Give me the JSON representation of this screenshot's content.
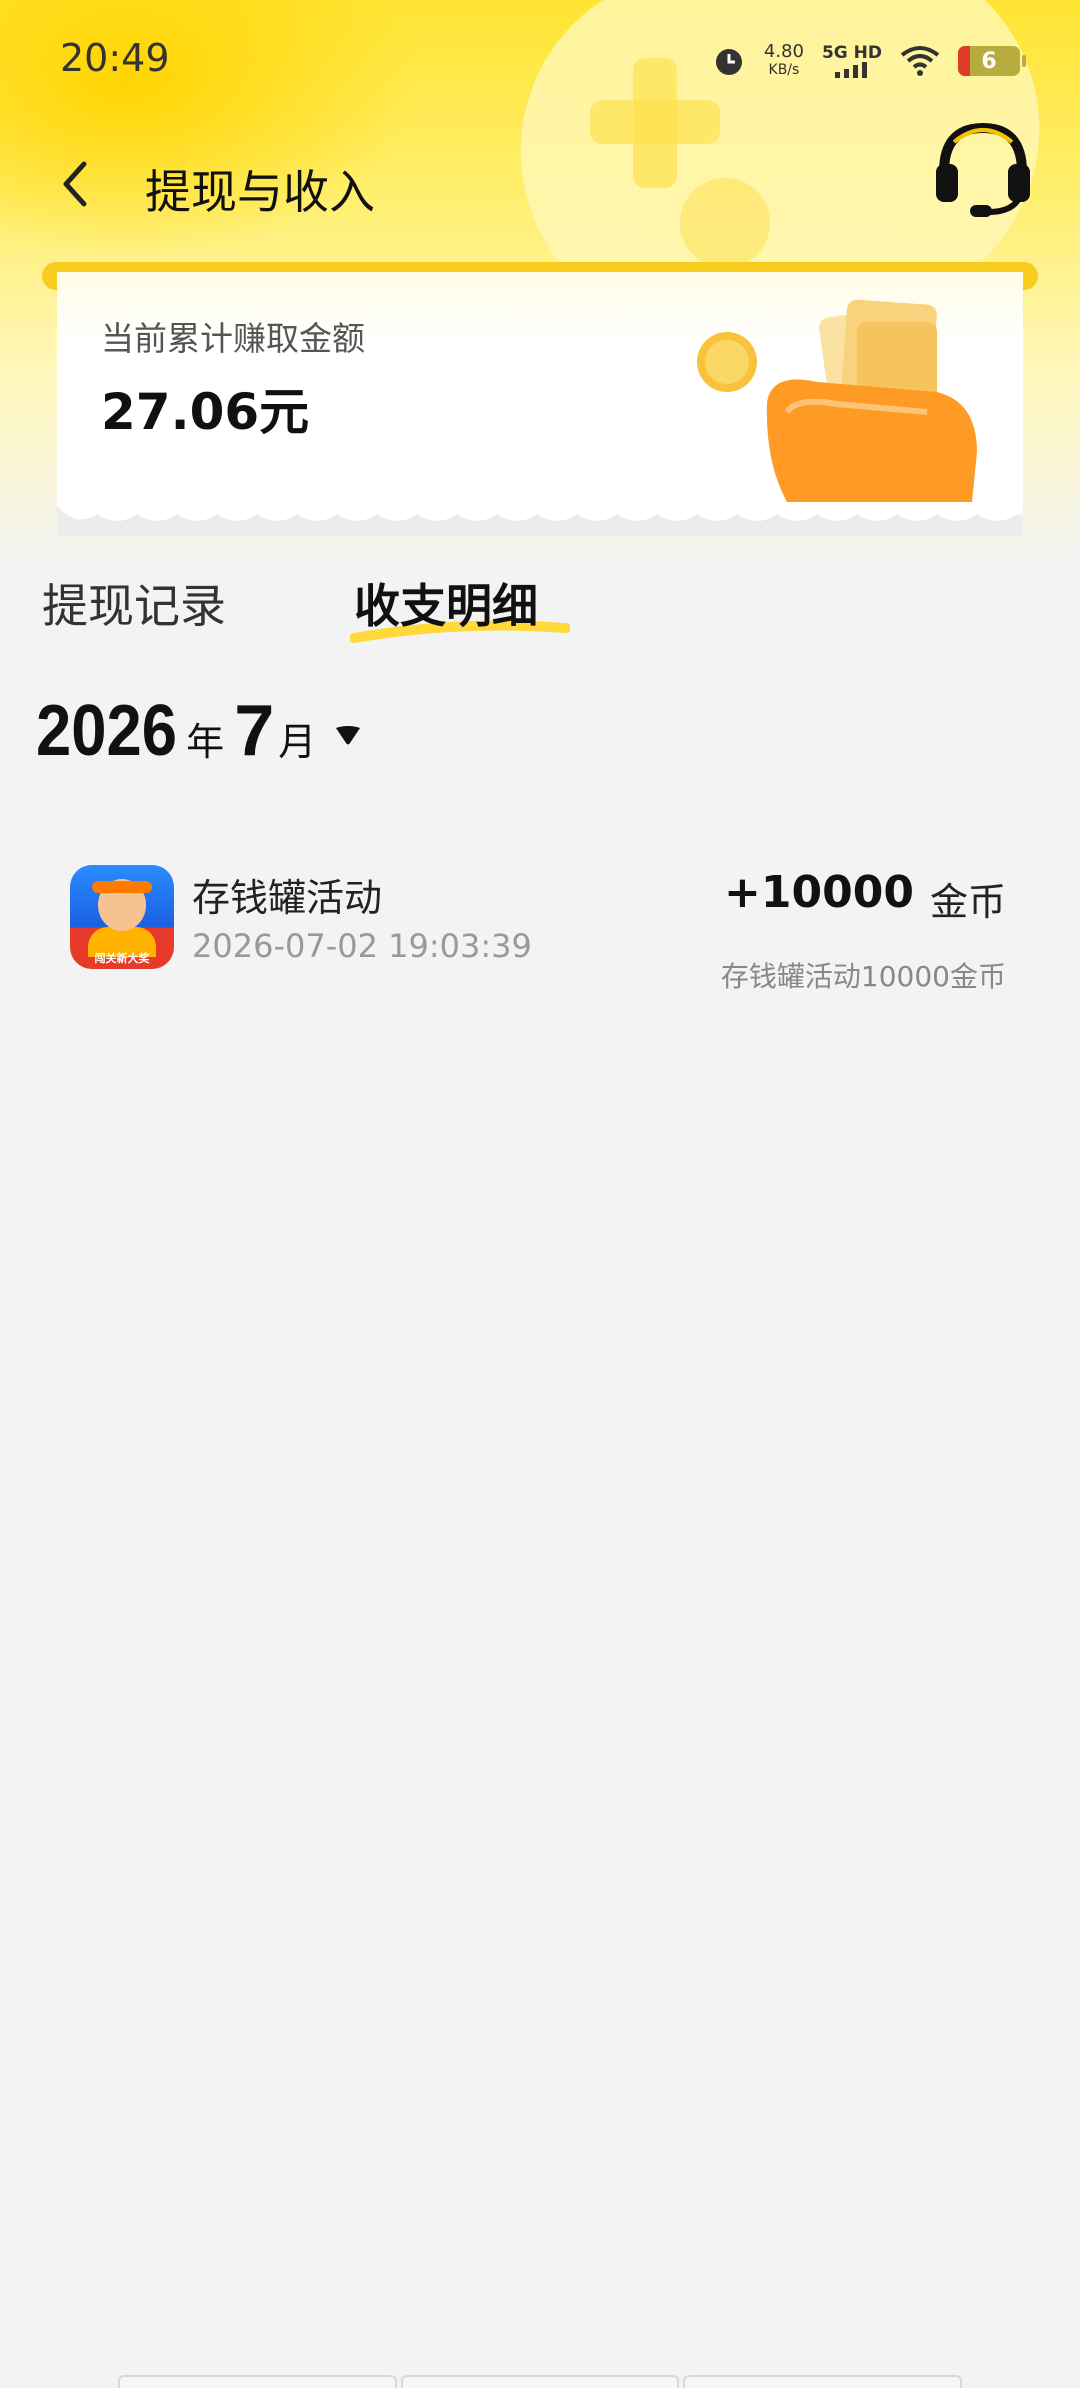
{
  "status_bar": {
    "time": "20:49",
    "speed_value": "4.80",
    "speed_unit": "KB/s",
    "network": "5G HD",
    "battery": "6"
  },
  "nav": {
    "title": "提现与收入"
  },
  "earnings_card": {
    "label": "当前累计赚取金额",
    "amount": "27.06元"
  },
  "tabs": [
    {
      "label": "提现记录",
      "active": false
    },
    {
      "label": "收支明细",
      "active": true
    }
  ],
  "month_selector": {
    "year": "2026",
    "year_unit": "年",
    "month": "7",
    "month_unit": "月"
  },
  "records": [
    {
      "title": "存钱罐活动",
      "time": "2026-07-02 19:03:39",
      "amount": "+10000",
      "unit": "金币",
      "description": "存钱罐活动10000金币",
      "icon": "app-game-icon",
      "icon_badge": "闯关新大奖"
    }
  ],
  "colors": {
    "brand_yellow": "#ffe433",
    "rail_yellow": "#f7cc1f",
    "background": "#f3f3f3"
  }
}
